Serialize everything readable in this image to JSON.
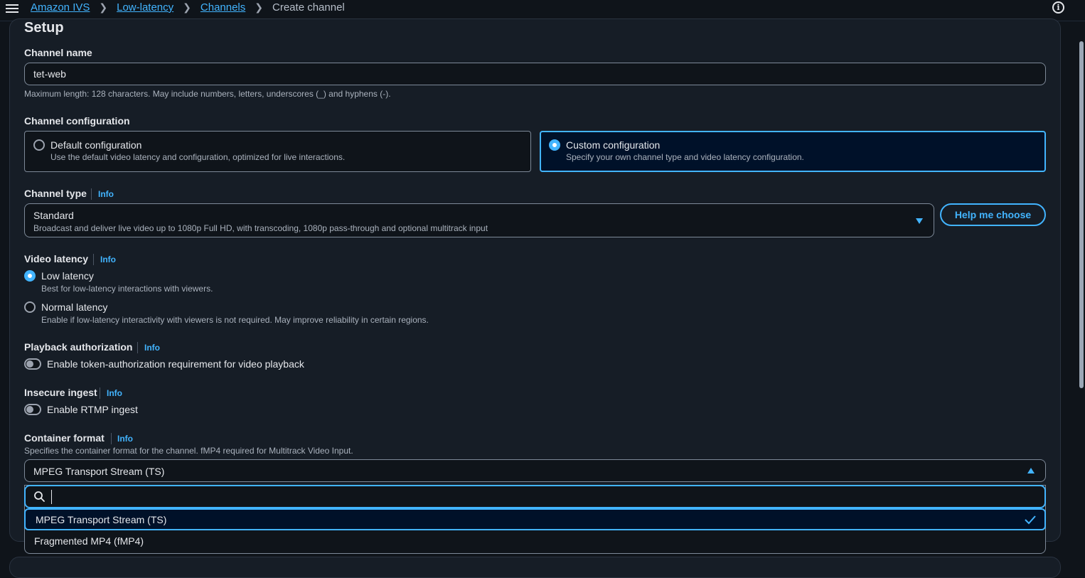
{
  "breadcrumbs": [
    {
      "label": "Amazon IVS"
    },
    {
      "label": "Low-latency"
    },
    {
      "label": "Channels"
    },
    {
      "label": "Create channel"
    }
  ],
  "setup": {
    "title": "Setup",
    "channel_name": {
      "label": "Channel name",
      "value": "tet-web",
      "hint": "Maximum length: 128 characters. May include numbers, letters, underscores (_) and hyphens (-)."
    },
    "channel_configuration": {
      "label": "Channel configuration",
      "options": [
        {
          "title": "Default configuration",
          "desc": "Use the default video latency and configuration, optimized for live interactions.",
          "selected": false
        },
        {
          "title": "Custom configuration",
          "desc": "Specify your own channel type and video latency configuration.",
          "selected": true
        }
      ]
    },
    "channel_type": {
      "label": "Channel type",
      "info": "Info",
      "selected_title": "Standard",
      "selected_desc": "Broadcast and deliver live video up to 1080p Full HD, with transcoding, 1080p pass-through and optional multitrack input",
      "help_button": "Help me choose"
    },
    "video_latency": {
      "label": "Video latency",
      "info": "Info",
      "options": [
        {
          "title": "Low latency",
          "desc": "Best for low-latency interactions with viewers.",
          "selected": true
        },
        {
          "title": "Normal latency",
          "desc": "Enable if low-latency interactivity with viewers is not required. May improve reliability in certain regions.",
          "selected": false
        }
      ]
    },
    "playback_authorization": {
      "label": "Playback authorization",
      "info": "Info",
      "toggle_label": "Enable token-authorization requirement for video playback",
      "enabled": false
    },
    "insecure_ingest": {
      "label": "Insecure ingest",
      "info": "Info",
      "toggle_label": "Enable RTMP ingest",
      "enabled": false
    },
    "container_format": {
      "label": "Container format",
      "info": "Info",
      "hint": "Specifies the container format for the channel. fMP4 required for Multitrack Video Input.",
      "selected": "MPEG Transport Stream (TS)",
      "search_value": "",
      "options": [
        {
          "label": "MPEG Transport Stream (TS)",
          "selected": true
        },
        {
          "label": "Fragmented MP4 (fMP4)",
          "selected": false
        }
      ]
    }
  },
  "colors": {
    "accent": "#42b4ff",
    "background": "#0f141a",
    "panel": "#161d26"
  },
  "icons": {
    "menu": "hamburger-icon",
    "info": "info-circle-icon",
    "search": "search-icon",
    "check": "check-icon",
    "caret": "caret-icon"
  }
}
